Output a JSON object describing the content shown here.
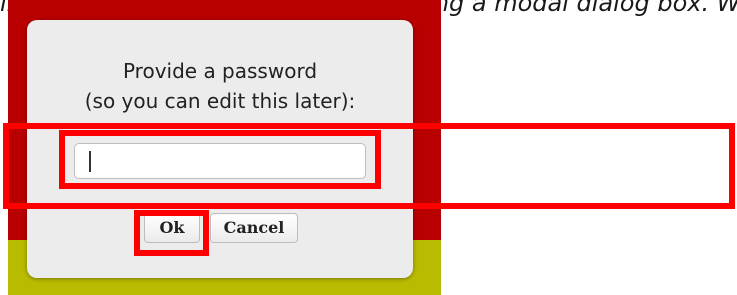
{
  "caption": {
    "text": "ing the user to enter a password using a modal dialog box. When they"
  },
  "dialog": {
    "message_line1": "Provide a password",
    "message_line2": "(so you can edit this later):",
    "input": {
      "value": "",
      "placeholder": ""
    },
    "ok_label": "Ok",
    "cancel_label": "Cancel"
  },
  "colors": {
    "background_red": "#b80000",
    "background_yellow": "#b9bb00",
    "highlight": "#ff0000",
    "dialog_bg": "#ececec"
  }
}
